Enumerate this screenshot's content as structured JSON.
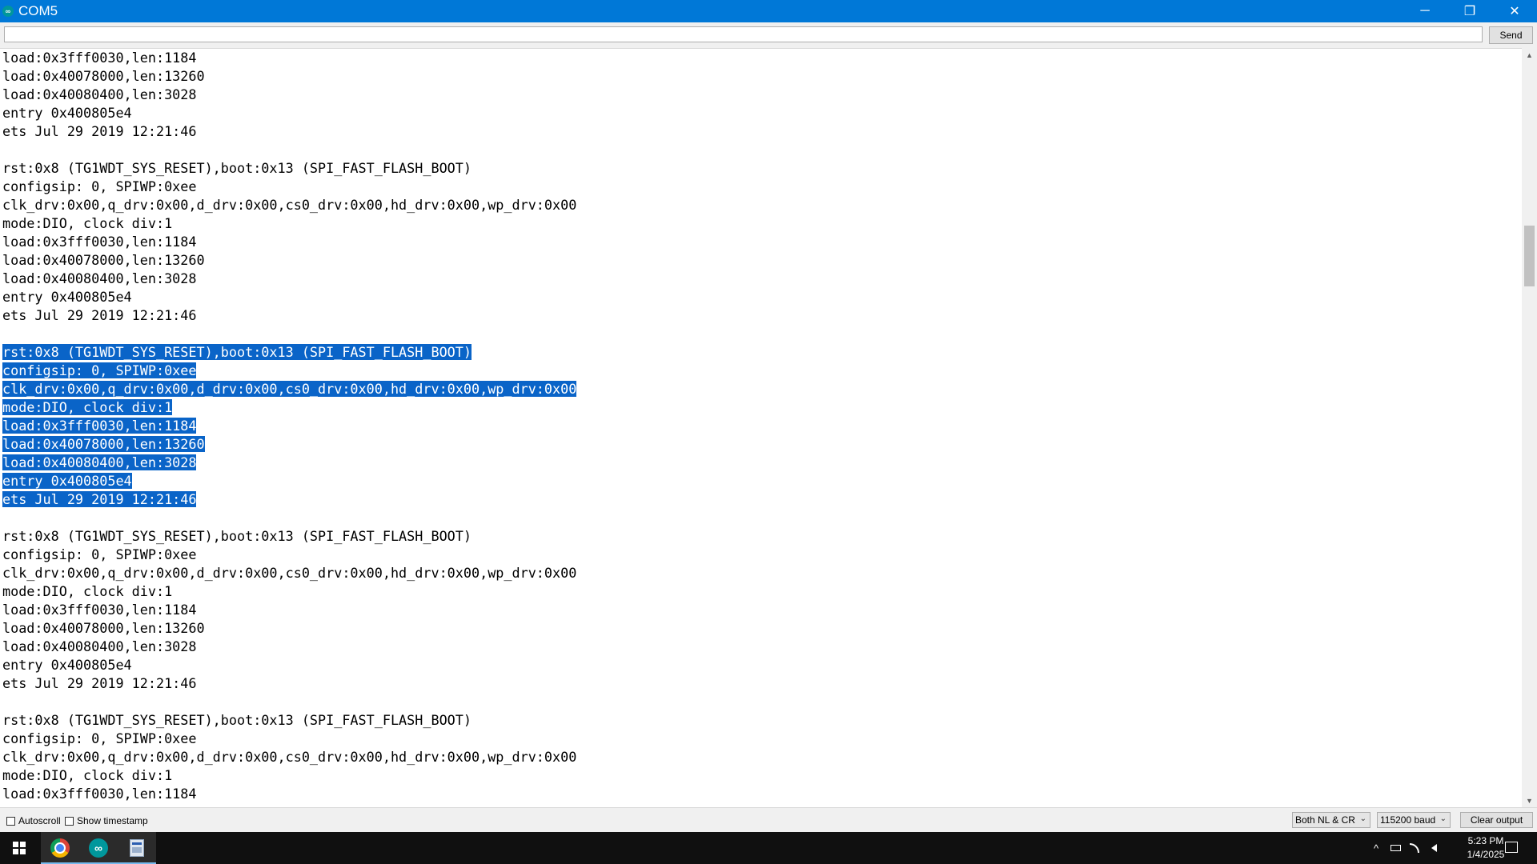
{
  "window": {
    "title": "COM5",
    "minimize_glyph": "─",
    "maximize_glyph": "❐",
    "close_glyph": "✕",
    "icon_glyph": "∞"
  },
  "send_bar": {
    "input_value": "",
    "send_label": "Send"
  },
  "output": {
    "highlight_color": "#0a64c8",
    "lines": [
      {
        "text": "load:0x3fff0030,len:1184",
        "selected": false
      },
      {
        "text": "load:0x40078000,len:13260",
        "selected": false
      },
      {
        "text": "load:0x40080400,len:3028",
        "selected": false
      },
      {
        "text": "entry 0x400805e4",
        "selected": false
      },
      {
        "text": "ets Jul 29 2019 12:21:46",
        "selected": false
      },
      {
        "text": "",
        "selected": false
      },
      {
        "text": "rst:0x8 (TG1WDT_SYS_RESET),boot:0x13 (SPI_FAST_FLASH_BOOT)",
        "selected": false
      },
      {
        "text": "configsip: 0, SPIWP:0xee",
        "selected": false
      },
      {
        "text": "clk_drv:0x00,q_drv:0x00,d_drv:0x00,cs0_drv:0x00,hd_drv:0x00,wp_drv:0x00",
        "selected": false
      },
      {
        "text": "mode:DIO, clock div:1",
        "selected": false
      },
      {
        "text": "load:0x3fff0030,len:1184",
        "selected": false
      },
      {
        "text": "load:0x40078000,len:13260",
        "selected": false
      },
      {
        "text": "load:0x40080400,len:3028",
        "selected": false
      },
      {
        "text": "entry 0x400805e4",
        "selected": false
      },
      {
        "text": "ets Jul 29 2019 12:21:46",
        "selected": false
      },
      {
        "text": "",
        "selected": false
      },
      {
        "text": "rst:0x8 (TG1WDT_SYS_RESET),boot:0x13 (SPI_FAST_FLASH_BOOT)",
        "selected": true
      },
      {
        "text": "configsip: 0, SPIWP:0xee",
        "selected": true
      },
      {
        "text": "clk_drv:0x00,q_drv:0x00,d_drv:0x00,cs0_drv:0x00,hd_drv:0x00,wp_drv:0x00",
        "selected": true
      },
      {
        "text": "mode:DIO, clock div:1",
        "selected": true
      },
      {
        "text": "load:0x3fff0030,len:1184",
        "selected": true
      },
      {
        "text": "load:0x40078000,len:13260",
        "selected": true
      },
      {
        "text": "load:0x40080400,len:3028",
        "selected": true
      },
      {
        "text": "entry 0x400805e4",
        "selected": true
      },
      {
        "text": "ets Jul 29 2019 12:21:46",
        "selected": true
      },
      {
        "text": "",
        "selected": false
      },
      {
        "text": "rst:0x8 (TG1WDT_SYS_RESET),boot:0x13 (SPI_FAST_FLASH_BOOT)",
        "selected": false
      },
      {
        "text": "configsip: 0, SPIWP:0xee",
        "selected": false
      },
      {
        "text": "clk_drv:0x00,q_drv:0x00,d_drv:0x00,cs0_drv:0x00,hd_drv:0x00,wp_drv:0x00",
        "selected": false
      },
      {
        "text": "mode:DIO, clock div:1",
        "selected": false
      },
      {
        "text": "load:0x3fff0030,len:1184",
        "selected": false
      },
      {
        "text": "load:0x40078000,len:13260",
        "selected": false
      },
      {
        "text": "load:0x40080400,len:3028",
        "selected": false
      },
      {
        "text": "entry 0x400805e4",
        "selected": false
      },
      {
        "text": "ets Jul 29 2019 12:21:46",
        "selected": false
      },
      {
        "text": "",
        "selected": false
      },
      {
        "text": "rst:0x8 (TG1WDT_SYS_RESET),boot:0x13 (SPI_FAST_FLASH_BOOT)",
        "selected": false
      },
      {
        "text": "configsip: 0, SPIWP:0xee",
        "selected": false
      },
      {
        "text": "clk_drv:0x00,q_drv:0x00,d_drv:0x00,cs0_drv:0x00,hd_drv:0x00,wp_drv:0x00",
        "selected": false
      },
      {
        "text": "mode:DIO, clock div:1",
        "selected": false
      },
      {
        "text": "load:0x3fff0030,len:1184",
        "selected": false
      }
    ]
  },
  "bottom_bar": {
    "autoscroll_label": "Autoscroll",
    "autoscroll_checked": false,
    "timestamp_label": "Show timestamp",
    "timestamp_checked": false,
    "line_ending_value": "Both NL & CR",
    "baud_value": "115200 baud",
    "clear_label": "Clear output"
  },
  "taskbar": {
    "clock_time": "5:23 PM",
    "clock_date": "1/4/2025",
    "tray_chevron": "^",
    "accent_color": "#76b9ed"
  }
}
